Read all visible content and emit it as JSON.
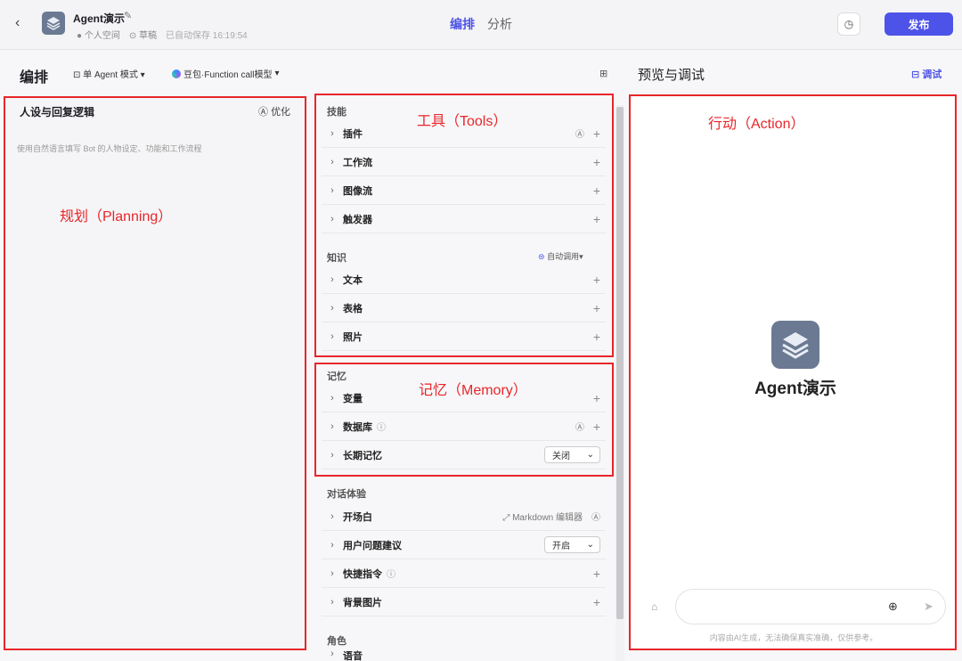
{
  "header": {
    "app_name": "Agent演示",
    "space": "个人空间",
    "status": "草稿",
    "saved": "已自动保存 16:19:54",
    "tabs": [
      "编排",
      "分析"
    ],
    "publish_label": "发布"
  },
  "editor": {
    "title": "编排",
    "mode": "单 Agent 模式",
    "model": "豆包·Function call模型"
  },
  "persona": {
    "title": "人设与回复逻辑",
    "optimize_label": "优化",
    "placeholder": "使用自然语言填写 Bot 的人物设定、功能和工作流程"
  },
  "skills": {
    "title": "技能",
    "items": [
      "插件",
      "工作流",
      "图像流",
      "触发器"
    ]
  },
  "knowledge": {
    "title": "知识",
    "auto_call": "自动调用",
    "items": [
      "文本",
      "表格",
      "照片"
    ]
  },
  "memory": {
    "title": "记忆",
    "items": [
      "变量",
      "数据库",
      "长期记忆"
    ],
    "long_term_value": "关闭"
  },
  "dialog": {
    "title": "对话体验",
    "items": [
      "开场白",
      "用户问题建议",
      "快捷指令",
      "背景图片"
    ],
    "opening_editor": "Markdown 编辑器",
    "suggestion_value": "开启"
  },
  "role": {
    "title": "角色",
    "items": [
      "语音"
    ]
  },
  "preview": {
    "title": "预览与调试",
    "debug_label": "调试",
    "bot_name": "Agent演示",
    "disclaimer": "内容由AI生成，无法确保真实准确，仅供参考。"
  },
  "annotations": {
    "planning": "规划（Planning）",
    "tools": "工具（Tools）",
    "memory": "记忆（Memory）",
    "action": "行动（Action）"
  },
  "colors": {
    "accent": "#4d53e8",
    "annotation_red": "#e8262a",
    "bot_logo": "#6b7a92"
  }
}
